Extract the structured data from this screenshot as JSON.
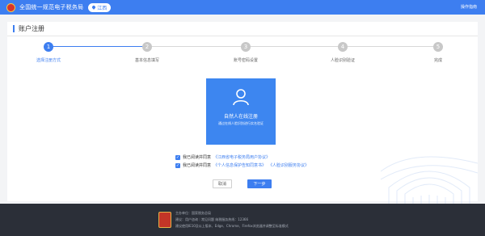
{
  "header": {
    "title": "全国统一规范电子税务局",
    "region": "江西",
    "help": "操作指南"
  },
  "panel": {
    "title": "账户注册"
  },
  "steps": [
    {
      "number": "1",
      "label": "选择注册方式",
      "active": true
    },
    {
      "number": "2",
      "label": "基本信息填写",
      "active": false
    },
    {
      "number": "3",
      "label": "账号密码设置",
      "active": false
    },
    {
      "number": "4",
      "label": "人脸识别验证",
      "active": false
    },
    {
      "number": "5",
      "label": "完成",
      "active": false
    }
  ],
  "card": {
    "title": "自然人在线注册",
    "subtitle": "通过在线人脸识别进行实名验证"
  },
  "agreements": [
    {
      "prefix": "我已阅读并同意",
      "links": [
        "《江西省电子税务局用户协议》"
      ]
    },
    {
      "prefix": "我已阅读并同意",
      "links": [
        "《个人信息保护告知同意书》",
        "《人脸识别服务协议》"
      ]
    }
  ],
  "buttons": {
    "cancel": "取消",
    "next": "下一步"
  },
  "footer": {
    "line1": "主办单位：国家税务总局",
    "line2": "建议：用户咨询｜常见问题    纳税服务热线：12366",
    "line3": "建议使用IE10及以上版本、Edge、Chrome、Firefox浏览器并调整至标准模式"
  },
  "colors": {
    "primary": "#3d7ef0",
    "card": "#3d86f0",
    "footer": "#2b2f38"
  }
}
